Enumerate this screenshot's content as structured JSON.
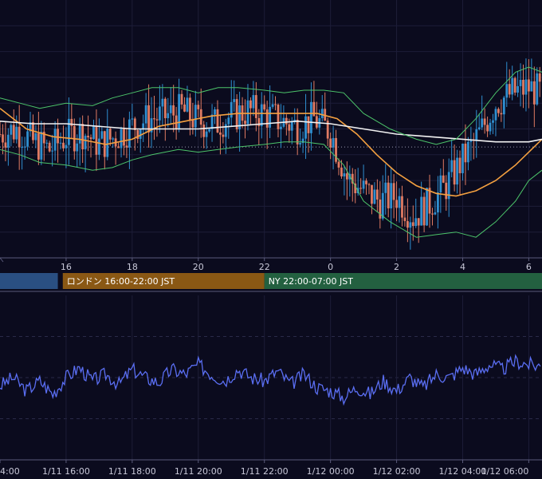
{
  "chart_data": [
    {
      "type": "candlestick",
      "x_unit": "hour (JST)",
      "x_ticks": [
        16,
        18,
        20,
        22,
        24,
        26,
        28,
        30
      ],
      "x_tick_labels": [
        "16",
        "18",
        "20",
        "22",
        "0",
        "2",
        "4",
        "6"
      ],
      "xlim": [
        14.0,
        30.4
      ],
      "y_axis": "hidden",
      "price_ylim": [
        0,
        100
      ],
      "reference_line": 43,
      "candle_interval_minutes": 5,
      "candles_close_series": [
        [
          14.0,
          48
        ],
        [
          14.5,
          50
        ],
        [
          15.0,
          45
        ],
        [
          15.5,
          42
        ],
        [
          16.0,
          47
        ],
        [
          16.5,
          49
        ],
        [
          17.0,
          44
        ],
        [
          17.5,
          47
        ],
        [
          18.0,
          51
        ],
        [
          18.5,
          54
        ],
        [
          19.0,
          55
        ],
        [
          19.5,
          57
        ],
        [
          20.0,
          53
        ],
        [
          20.5,
          52
        ],
        [
          21.0,
          55
        ],
        [
          21.5,
          57
        ],
        [
          22.0,
          56
        ],
        [
          22.5,
          53
        ],
        [
          23.0,
          51
        ],
        [
          23.5,
          54
        ],
        [
          24.0,
          49
        ],
        [
          24.5,
          31
        ],
        [
          25.0,
          26
        ],
        [
          25.5,
          22
        ],
        [
          26.0,
          24
        ],
        [
          26.5,
          16
        ],
        [
          27.0,
          21
        ],
        [
          27.5,
          28
        ],
        [
          28.0,
          38
        ],
        [
          28.5,
          48
        ],
        [
          29.0,
          60
        ],
        [
          29.5,
          64
        ],
        [
          30.0,
          66
        ],
        [
          30.4,
          64
        ]
      ],
      "indicators": [
        {
          "name": "ma-short",
          "color": "#f4a040",
          "points": [
            [
              14.0,
              58
            ],
            [
              14.8,
              50
            ],
            [
              15.6,
              47
            ],
            [
              16.4,
              46
            ],
            [
              17.2,
              44
            ],
            [
              18.0,
              46
            ],
            [
              18.8,
              51
            ],
            [
              19.6,
              53
            ],
            [
              20.4,
              55
            ],
            [
              21.2,
              56
            ],
            [
              22.0,
              56
            ],
            [
              22.8,
              56
            ],
            [
              23.6,
              56
            ],
            [
              24.2,
              54
            ],
            [
              24.8,
              48
            ],
            [
              25.4,
              40
            ],
            [
              26.0,
              33
            ],
            [
              26.6,
              28
            ],
            [
              27.2,
              25
            ],
            [
              27.8,
              24
            ],
            [
              28.4,
              26
            ],
            [
              29.0,
              30
            ],
            [
              29.6,
              36
            ],
            [
              30.4,
              46
            ]
          ]
        },
        {
          "name": "ma-long",
          "color": "#f2f2f2",
          "points": [
            [
              14.0,
              53
            ],
            [
              15.0,
              52
            ],
            [
              16.0,
              52
            ],
            [
              17.0,
              51
            ],
            [
              18.0,
              50
            ],
            [
              19.0,
              50
            ],
            [
              20.0,
              50
            ],
            [
              21.0,
              51
            ],
            [
              22.0,
              52
            ],
            [
              23.0,
              53
            ],
            [
              24.0,
              52
            ],
            [
              25.0,
              50
            ],
            [
              26.0,
              48
            ],
            [
              27.0,
              47
            ],
            [
              28.0,
              46
            ],
            [
              29.0,
              45
            ],
            [
              30.0,
              45
            ],
            [
              30.4,
              46
            ]
          ]
        },
        {
          "name": "bollinger-upper",
          "color": "#4cc46a",
          "points": [
            [
              14.0,
              62
            ],
            [
              14.6,
              60
            ],
            [
              15.2,
              58
            ],
            [
              16.0,
              60
            ],
            [
              16.8,
              59
            ],
            [
              17.4,
              62
            ],
            [
              18.0,
              64
            ],
            [
              18.6,
              66
            ],
            [
              19.4,
              66
            ],
            [
              20.0,
              64
            ],
            [
              20.6,
              66
            ],
            [
              21.2,
              66
            ],
            [
              22.0,
              65
            ],
            [
              22.6,
              64
            ],
            [
              23.2,
              65
            ],
            [
              23.8,
              65
            ],
            [
              24.4,
              64
            ],
            [
              25.0,
              56
            ],
            [
              25.8,
              50
            ],
            [
              26.6,
              46
            ],
            [
              27.2,
              44
            ],
            [
              27.8,
              46
            ],
            [
              28.4,
              54
            ],
            [
              29.0,
              64
            ],
            [
              29.6,
              72
            ],
            [
              30.0,
              74
            ],
            [
              30.4,
              72
            ]
          ]
        },
        {
          "name": "bollinger-lower",
          "color": "#4cc46a",
          "points": [
            [
              14.0,
              42
            ],
            [
              14.6,
              40
            ],
            [
              15.2,
              37
            ],
            [
              16.0,
              36
            ],
            [
              16.8,
              34
            ],
            [
              17.4,
              35
            ],
            [
              18.0,
              38
            ],
            [
              18.6,
              40
            ],
            [
              19.4,
              42
            ],
            [
              20.0,
              41
            ],
            [
              20.6,
              42
            ],
            [
              21.2,
              43
            ],
            [
              22.0,
              44
            ],
            [
              22.6,
              45
            ],
            [
              23.2,
              45
            ],
            [
              23.8,
              44
            ],
            [
              24.4,
              36
            ],
            [
              25.0,
              22
            ],
            [
              25.8,
              14
            ],
            [
              26.6,
              8
            ],
            [
              27.2,
              9
            ],
            [
              27.8,
              10
            ],
            [
              28.4,
              8
            ],
            [
              29.0,
              14
            ],
            [
              29.6,
              22
            ],
            [
              30.0,
              30
            ],
            [
              30.4,
              34
            ]
          ]
        }
      ],
      "colors": {
        "up": "#2f8fd0",
        "down": "#e07b63",
        "grid": "#1d1d38",
        "axis": "#5a5a7a"
      }
    },
    {
      "type": "band",
      "sessions": [
        {
          "label": "",
          "start": 14.0,
          "end": 15.75,
          "color": "#2a4f82"
        },
        {
          "label": "ロンドン 16:00-22:00 JST",
          "start": 15.9,
          "end": 22.0,
          "color": "#8a5814"
        },
        {
          "label": "NY 22:00-07:00 JST",
          "start": 22.0,
          "end": 30.4,
          "color": "#236040"
        }
      ]
    },
    {
      "type": "line",
      "x_tick_labels": [
        "4:00",
        "1/11 16:00",
        "1/11 18:00",
        "1/11 20:00",
        "1/11 22:00",
        "1/12 00:00",
        "1/12 02:00",
        "1/12 04:00",
        "1/12 06:00"
      ],
      "x_ticks": [
        14,
        16,
        18,
        20,
        22,
        24,
        26,
        28,
        30
      ],
      "ylim": [
        0,
        100
      ],
      "reference_lines": [
        75,
        50,
        25
      ],
      "series": [
        {
          "color": "#5a6ef2",
          "points": [
            [
              14.0,
              45
            ],
            [
              14.4,
              50
            ],
            [
              14.8,
              42
            ],
            [
              15.2,
              48
            ],
            [
              15.6,
              40
            ],
            [
              16.0,
              50
            ],
            [
              16.4,
              56
            ],
            [
              16.8,
              48
            ],
            [
              17.2,
              52
            ],
            [
              17.6,
              46
            ],
            [
              18.0,
              55
            ],
            [
              18.4,
              50
            ],
            [
              18.8,
              47
            ],
            [
              19.2,
              55
            ],
            [
              19.6,
              52
            ],
            [
              20.0,
              58
            ],
            [
              20.4,
              52
            ],
            [
              20.8,
              48
            ],
            [
              21.2,
              55
            ],
            [
              21.6,
              50
            ],
            [
              22.0,
              48
            ],
            [
              22.4,
              54
            ],
            [
              22.8,
              46
            ],
            [
              23.2,
              52
            ],
            [
              23.6,
              44
            ],
            [
              24.0,
              42
            ],
            [
              24.4,
              38
            ],
            [
              24.8,
              44
            ],
            [
              25.2,
              40
            ],
            [
              25.6,
              48
            ],
            [
              26.0,
              42
            ],
            [
              26.4,
              50
            ],
            [
              26.8,
              44
            ],
            [
              27.2,
              52
            ],
            [
              27.6,
              50
            ],
            [
              28.0,
              56
            ],
            [
              28.4,
              52
            ],
            [
              28.8,
              58
            ],
            [
              29.2,
              55
            ],
            [
              29.6,
              60
            ],
            [
              30.0,
              58
            ],
            [
              30.4,
              57
            ]
          ]
        }
      ]
    }
  ]
}
